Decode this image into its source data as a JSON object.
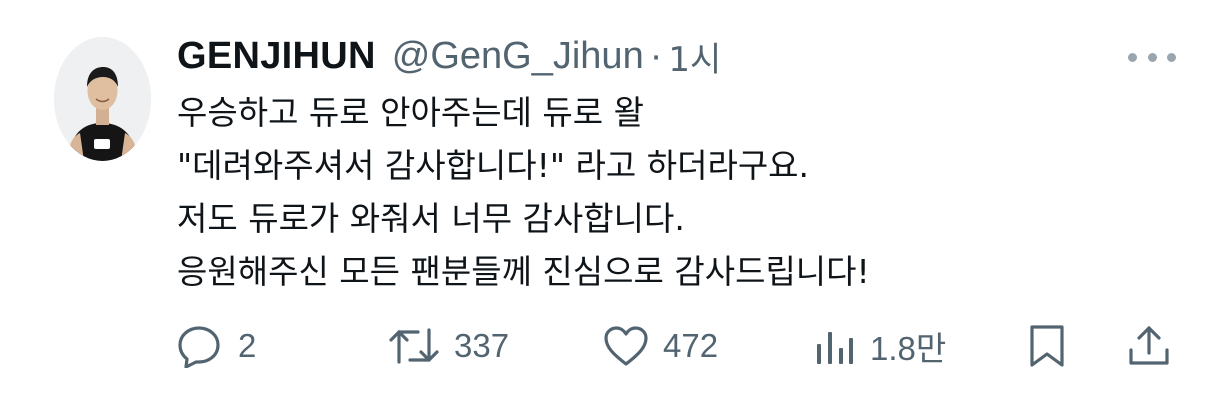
{
  "tweet": {
    "display_name": "GENJIHUN",
    "handle": "@GenG_Jihun",
    "separator": "·",
    "time": "1시",
    "lines": [
      "우승하고 듀로 안아주는데 듀로 왈",
      "\"데려와주셔서 감사합니다!\" 라고 하더라구요.",
      "저도 듀로가 와줘서 너무 감사합니다.",
      "응원해주신 모든 팬분들께 진심으로 감사드립니다!"
    ]
  },
  "actions": {
    "replies": "2",
    "retweets": "337",
    "likes": "472",
    "views": "1.8만"
  },
  "icons": {
    "avatar": "avatar-photo",
    "more": "more-icon",
    "reply": "reply-icon",
    "retweet": "retweet-icon",
    "like": "heart-icon",
    "views": "views-icon",
    "bookmark": "bookmark-icon",
    "share": "share-icon"
  },
  "colors": {
    "text": "#0f1419",
    "secondary": "#536471",
    "icon": "#536471"
  }
}
